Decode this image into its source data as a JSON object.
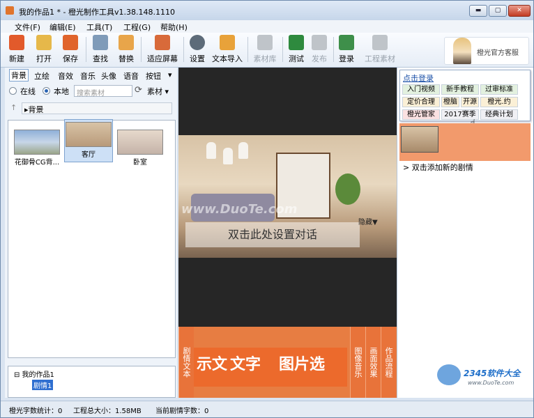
{
  "window": {
    "title": "我的作品1 * - 橙光制作工具v1.38.148.1110",
    "min": "▬",
    "max": "▢",
    "close": "✕"
  },
  "menu": [
    "文件(F)",
    "编辑(E)",
    "工具(T)",
    "工程(G)",
    "帮助(H)"
  ],
  "toolbar": {
    "new": "新建",
    "open": "打开",
    "save": "保存",
    "find": "查找",
    "replace": "替换",
    "fit_screen": "适应屏幕",
    "settings": "设置",
    "text_import": "文本导入",
    "library": "素材库",
    "test": "测试",
    "publish": "发布",
    "login": "登录",
    "project_assets": "工程素材"
  },
  "brand": {
    "text": "橙光官方客服"
  },
  "left": {
    "tabs": [
      "背景",
      "立绘",
      "音效",
      "音乐",
      "头像",
      "语音",
      "按钮"
    ],
    "more": "▾",
    "online": "在线",
    "local": "本地",
    "search_placeholder": "搜索素材",
    "refresh": "⟳",
    "material": "素材 ▾",
    "path_up": "↑",
    "path": "▸背景",
    "thumbs": [
      "花御骨CG背...",
      "客厅",
      "卧室"
    ],
    "tree_root": "⊟ 我的作品1",
    "tree_child": "剧情1"
  },
  "stage": {
    "dialog": "双击此处设置对话",
    "hide": "隐藏▼",
    "watermark": "www.DuoTe.com"
  },
  "bottom": {
    "tab_text": "剧情文本",
    "cards": [
      "示文",
      "文字",
      "图片选"
    ],
    "tab_music": "图像音乐",
    "tab_effect": "画面效果",
    "tab_flow": "作品流程"
  },
  "popup": {
    "login": "点击登录",
    "chips": [
      "入门视频",
      "新手教程",
      "过审标准",
      "定价合理",
      "橙脑",
      "开源",
      "橙光.约",
      "橙光管家",
      "2017赛季",
      "经典计划"
    ]
  },
  "right": {
    "add_new": "> 双击添加新的剧情"
  },
  "status": {
    "word_count": "橙光字数统计：0",
    "project_size": "工程总大小：1.58MB",
    "current_words": "当前剧情字数：0"
  },
  "watermark_site": {
    "logo": "2345软件大全",
    "url": "www.DuoTe.com"
  }
}
